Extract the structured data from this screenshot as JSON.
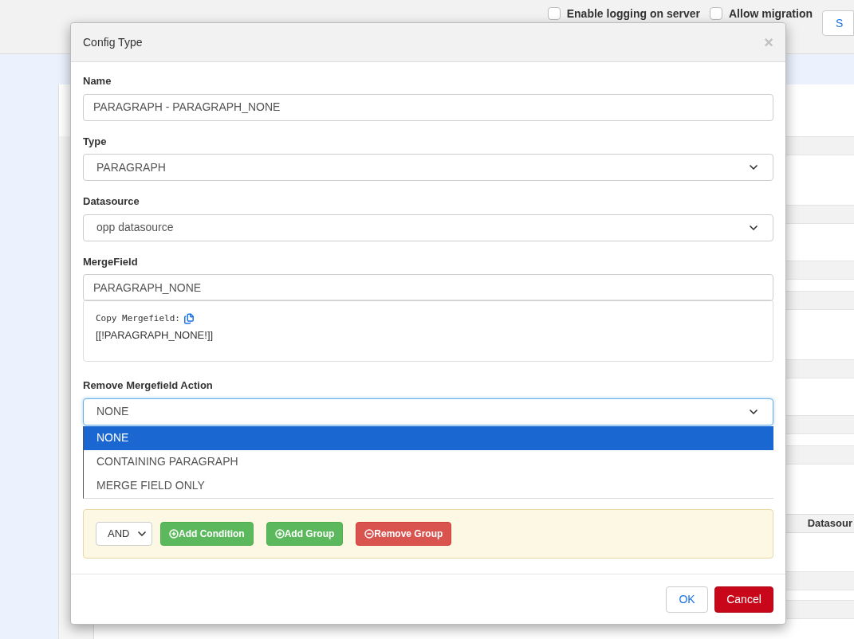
{
  "background": {
    "checkboxes": [
      {
        "label": "Enable logging on server",
        "checked": false
      },
      {
        "label": "Allow migration",
        "checked": false
      }
    ],
    "button": "S",
    "table_header": "Datasour"
  },
  "dialog": {
    "title": "Config Type",
    "close": "×",
    "fields": [
      {
        "kind": "input",
        "label": "Name",
        "value": "PARAGRAPH - PARAGRAPH_NONE"
      },
      {
        "kind": "select",
        "label": "Type",
        "value": "PARAGRAPH"
      },
      {
        "kind": "select",
        "label": "Datasource",
        "value": "opp datasource"
      },
      {
        "kind": "input",
        "label": "MergeField",
        "value": "PARAGRAPH_NONE"
      }
    ],
    "copy_box": {
      "label": "Copy Mergefield:",
      "value": "[[!PARAGRAPH_NONE!]]"
    },
    "action": {
      "label": "Remove Mergefield Action",
      "value": "NONE",
      "expanded": true,
      "options": [
        {
          "label": "NONE",
          "selected": true
        },
        {
          "label": "CONTAINING PARAGRAPH",
          "selected": false
        },
        {
          "label": "MERGE FIELD ONLY",
          "selected": false
        }
      ]
    },
    "conditions": {
      "operator": "AND",
      "buttons": [
        {
          "kind": "add",
          "label": "Add Condition"
        },
        {
          "kind": "add",
          "label": "Add Group"
        },
        {
          "kind": "remove",
          "label": "Remove Group"
        }
      ]
    },
    "footer": [
      {
        "kind": "default",
        "label": "OK"
      },
      {
        "kind": "danger",
        "label": "Cancel"
      }
    ]
  }
}
